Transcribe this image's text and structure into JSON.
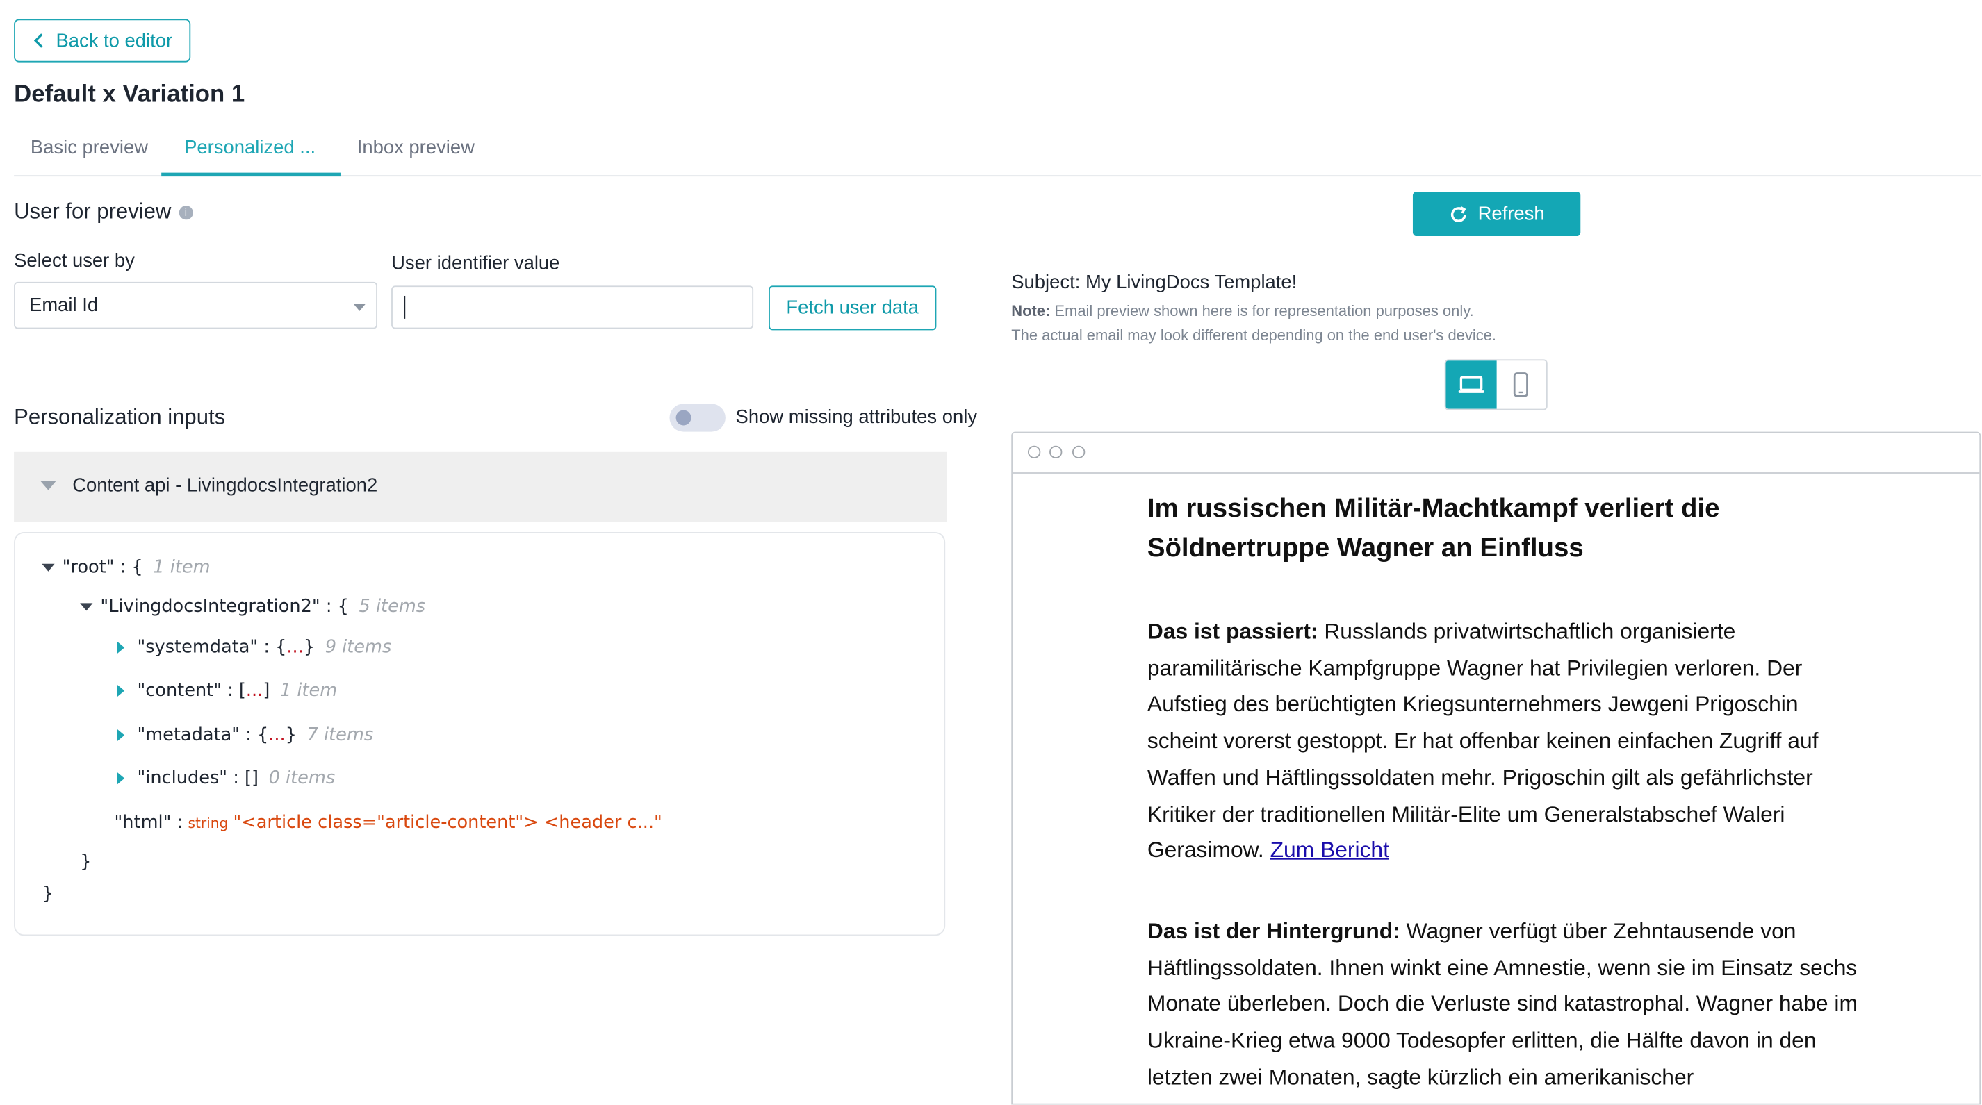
{
  "header": {
    "back_label": "Back to editor",
    "title": "Default x Variation 1",
    "tabs": [
      {
        "label": "Basic preview",
        "active": false
      },
      {
        "label": "Personalized ...",
        "active": true
      },
      {
        "label": "Inbox preview",
        "active": false
      }
    ]
  },
  "user_preview": {
    "title": "User for preview",
    "select_label": "Select user by",
    "select_value": "Email Id",
    "identifier_label": "User identifier value",
    "identifier_value": "",
    "fetch_label": "Fetch user data"
  },
  "personalization": {
    "title": "Personalization inputs",
    "toggle_label": "Show missing attributes only",
    "toggle_on": false,
    "accordion_label": "Content api - LivingdocsIntegration2",
    "json": {
      "root_key": "\"root\"",
      "root_count": "1 item",
      "integration_key": "\"LivingdocsIntegration2\"",
      "integration_count": "5 items",
      "systemdata_key": "\"systemdata\"",
      "systemdata_count": "9 items",
      "content_key": "\"content\"",
      "content_count": "1 item",
      "metadata_key": "\"metadata\"",
      "metadata_count": "7 items",
      "includes_key": "\"includes\"",
      "includes_count": "0 items",
      "html_key": "\"html\"",
      "html_type": "string",
      "html_value": "\"<article class=\"article-content\"> <header c...\""
    }
  },
  "preview": {
    "refresh_label": "Refresh",
    "subject": "Subject: My LivingDocs Template!",
    "note_bold": "Note:",
    "note_line1": "Email preview shown here is for representation purposes only.",
    "note_line2": "The actual email may look different depending on the end user's device.",
    "email": {
      "headline": "Im russischen Militär-Machtkampf verliert die Söldnertruppe Wagner an Einfluss",
      "p1_bold": "Das ist passiert:",
      "p1_text": " Russlands privatwirtschaftlich organisierte paramilitärische Kampfgruppe Wagner hat Privilegien verloren. Der Aufstieg des berüchtigten Kriegsunternehmers Jewgeni Prigoschin scheint vorerst gestoppt. Er hat offenbar keinen einfachen Zugriff auf Waffen und Häftlingssoldaten mehr. Prigoschin gilt als gefährlichster Kritiker der traditionellen Militär-Elite um Generalstabschef Waleri Gerasimow. ",
      "p1_link": "Zum Bericht",
      "p2_bold": "Das ist der Hintergrund:",
      "p2_text": " Wagner verfügt über Zehntausende von Häftlingssoldaten. Ihnen winkt eine Amnestie, wenn sie im Einsatz sechs Monate überleben. Doch die Verluste sind katastrophal. Wagner habe im Ukraine-Krieg etwa 9000 Todesopfer erlitten, die Hälfte davon in den letzten zwei Monaten, sagte kürzlich ein amerikanischer"
    }
  },
  "colors": {
    "accent": "#1ea6b4",
    "accent_fill": "#14a7b5",
    "json_red": "#c1121f",
    "json_string": "#d9480f"
  }
}
